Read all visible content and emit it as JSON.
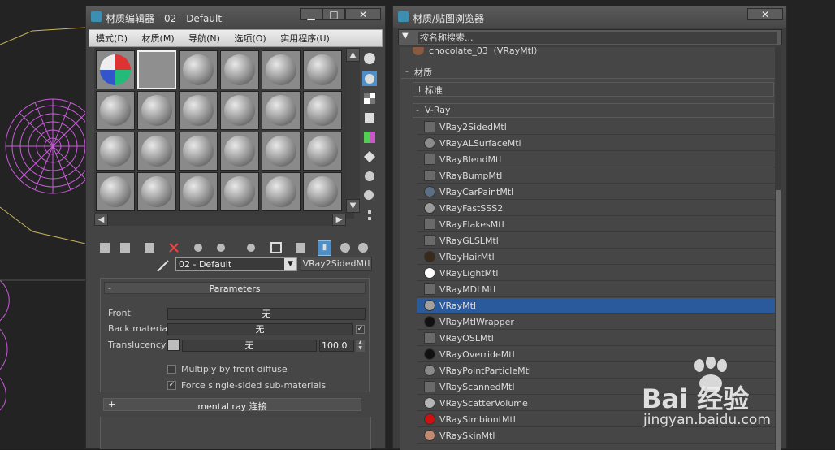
{
  "material_editor": {
    "title": "材质编辑器 - 02 - Default",
    "menu": [
      "模式(D)",
      "材质(M)",
      "导航(N)",
      "选项(O)",
      "实用程序(U)"
    ],
    "material_name": "02 - Default",
    "material_type_button": "VRay2SidedMtl",
    "parameters": {
      "header": "Parameters",
      "collapse": "-",
      "front_label": "Front",
      "front_value": "无",
      "back_label": "Back material:",
      "back_value": "无",
      "translucency_label": "Translucency:",
      "translucency_value": "无",
      "translucency_amount": "100.0",
      "multiply_label": "Multiply by front diffuse",
      "force_label": "Force single-sided sub-materials"
    },
    "mental_ray": {
      "expand": "+",
      "label": "mental ray 连接"
    }
  },
  "browser": {
    "title": "材质/贴图浏览器",
    "search_placeholder": "按名称搜索...",
    "top_item": "chocolate_03（VRayMtl）",
    "group": "材质",
    "group_toggle": "-",
    "standard": "标准",
    "standard_toggle": "+",
    "vray": "V-Ray",
    "vray_toggle": "-",
    "items": [
      {
        "name": "VRay2SidedMtl",
        "swatch": "#6a6a6a"
      },
      {
        "name": "VRayALSurfaceMtl",
        "swatch": "#8b8b8b"
      },
      {
        "name": "VRayBlendMtl",
        "swatch": "#6a6a6a"
      },
      {
        "name": "VRayBumpMtl",
        "swatch": "#6a6a6a"
      },
      {
        "name": "VRayCarPaintMtl",
        "swatch": "#5b6f86"
      },
      {
        "name": "VRayFastSSS2",
        "swatch": "#9a9a9a"
      },
      {
        "name": "VRayFlakesMtl",
        "swatch": "#6a6a6a"
      },
      {
        "name": "VRayGLSLMtl",
        "swatch": "#6a6a6a"
      },
      {
        "name": "VRayHairMtl",
        "swatch": "#3a2a1a"
      },
      {
        "name": "VRayLightMtl",
        "swatch": "#ffffff"
      },
      {
        "name": "VRayMDLMtl",
        "swatch": "#6a6a6a"
      },
      {
        "name": "VRayMtl",
        "swatch": "#a0a0a0"
      },
      {
        "name": "VRayMtlWrapper",
        "swatch": "#111111"
      },
      {
        "name": "VRayOSLMtl",
        "swatch": "#6a6a6a"
      },
      {
        "name": "VRayOverrideMtl",
        "swatch": "#111111"
      },
      {
        "name": "VRayPointParticleMtl",
        "swatch": "#8a8a8a"
      },
      {
        "name": "VRayScannedMtl",
        "swatch": "#6a6a6a"
      },
      {
        "name": "VRayScatterVolume",
        "swatch": "#b4b4b4"
      },
      {
        "name": "VRaySimbiontMtl",
        "swatch": "#cc1111"
      },
      {
        "name": "VRaySkinMtl",
        "swatch": "#c08a70"
      }
    ],
    "selected_index": 11
  },
  "watermark": {
    "brand": "Bai 经验",
    "url": "jingyan.baidu.com"
  }
}
